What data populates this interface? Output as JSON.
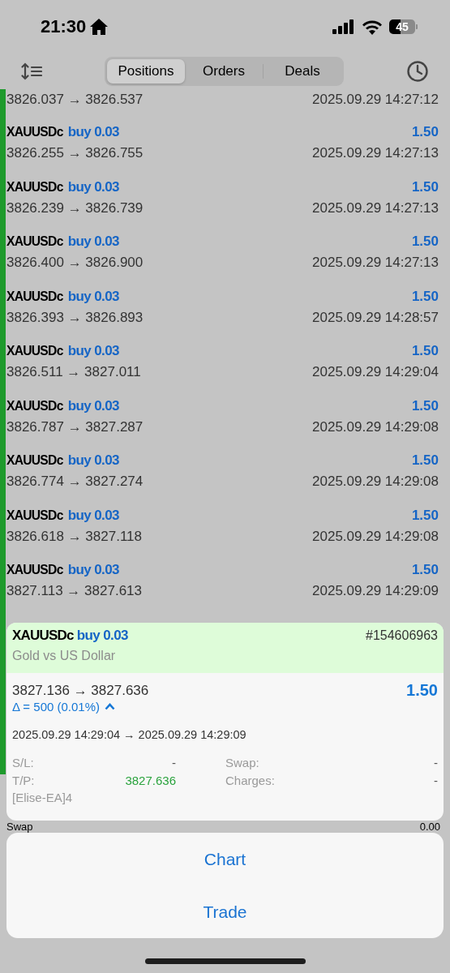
{
  "status_bar": {
    "time": "21:30",
    "battery": "45"
  },
  "tabs": [
    {
      "label": "Positions",
      "selected": true
    },
    {
      "label": "Orders",
      "selected": false
    },
    {
      "label": "Deals",
      "selected": false
    }
  ],
  "positions": [
    {
      "prices": "3826.037 → 3826.537",
      "time": "2025.09.29 14:27:12"
    },
    {
      "symbol": "XAUUSDc",
      "side": "buy 0.03",
      "profit": "1.50",
      "prices": "3826.255 → 3826.755",
      "time": "2025.09.29 14:27:13"
    },
    {
      "symbol": "XAUUSDc",
      "side": "buy 0.03",
      "profit": "1.50",
      "prices": "3826.239 → 3826.739",
      "time": "2025.09.29 14:27:13"
    },
    {
      "symbol": "XAUUSDc",
      "side": "buy 0.03",
      "profit": "1.50",
      "prices": "3826.400 → 3826.900",
      "time": "2025.09.29 14:27:13"
    },
    {
      "symbol": "XAUUSDc",
      "side": "buy 0.03",
      "profit": "1.50",
      "prices": "3826.393 → 3826.893",
      "time": "2025.09.29 14:28:57"
    },
    {
      "symbol": "XAUUSDc",
      "side": "buy 0.03",
      "profit": "1.50",
      "prices": "3826.511 → 3827.011",
      "time": "2025.09.29 14:29:04"
    },
    {
      "symbol": "XAUUSDc",
      "side": "buy 0.03",
      "profit": "1.50",
      "prices": "3826.787 → 3827.287",
      "time": "2025.09.29 14:29:08"
    },
    {
      "symbol": "XAUUSDc",
      "side": "buy 0.03",
      "profit": "1.50",
      "prices": "3826.774 → 3827.274",
      "time": "2025.09.29 14:29:08"
    },
    {
      "symbol": "XAUUSDc",
      "side": "buy 0.03",
      "profit": "1.50",
      "prices": "3826.618 → 3827.118",
      "time": "2025.09.29 14:29:08"
    },
    {
      "symbol": "XAUUSDc",
      "side": "buy 0.03",
      "profit": "1.50",
      "prices": "3827.113 → 3827.613",
      "time": "2025.09.29 14:29:09"
    }
  ],
  "summary_row": {
    "label": "Swap",
    "value": "0.00"
  },
  "detail": {
    "symbol": "XAUUSDc",
    "side": "buy 0.03",
    "ticket": "#154606963",
    "description": "Gold vs US Dollar",
    "prices": "3827.136 → 3827.636",
    "profit": "1.50",
    "delta": "Δ = 500 (0.01%)",
    "expanded": true,
    "times": "2025.09.29 14:29:04 → 2025.09.29 14:29:09",
    "fields": [
      {
        "label": "S/L:",
        "value": "-",
        "kind": "plain"
      },
      {
        "label": "Swap:",
        "value": "-",
        "kind": "plain"
      },
      {
        "label": "T/P:",
        "value": "3827.636",
        "kind": "profit"
      },
      {
        "label": "Charges:",
        "value": "-",
        "kind": "plain"
      }
    ],
    "comment": "[Elise-EA]4"
  },
  "actions": [
    "Chart",
    "Trade"
  ]
}
